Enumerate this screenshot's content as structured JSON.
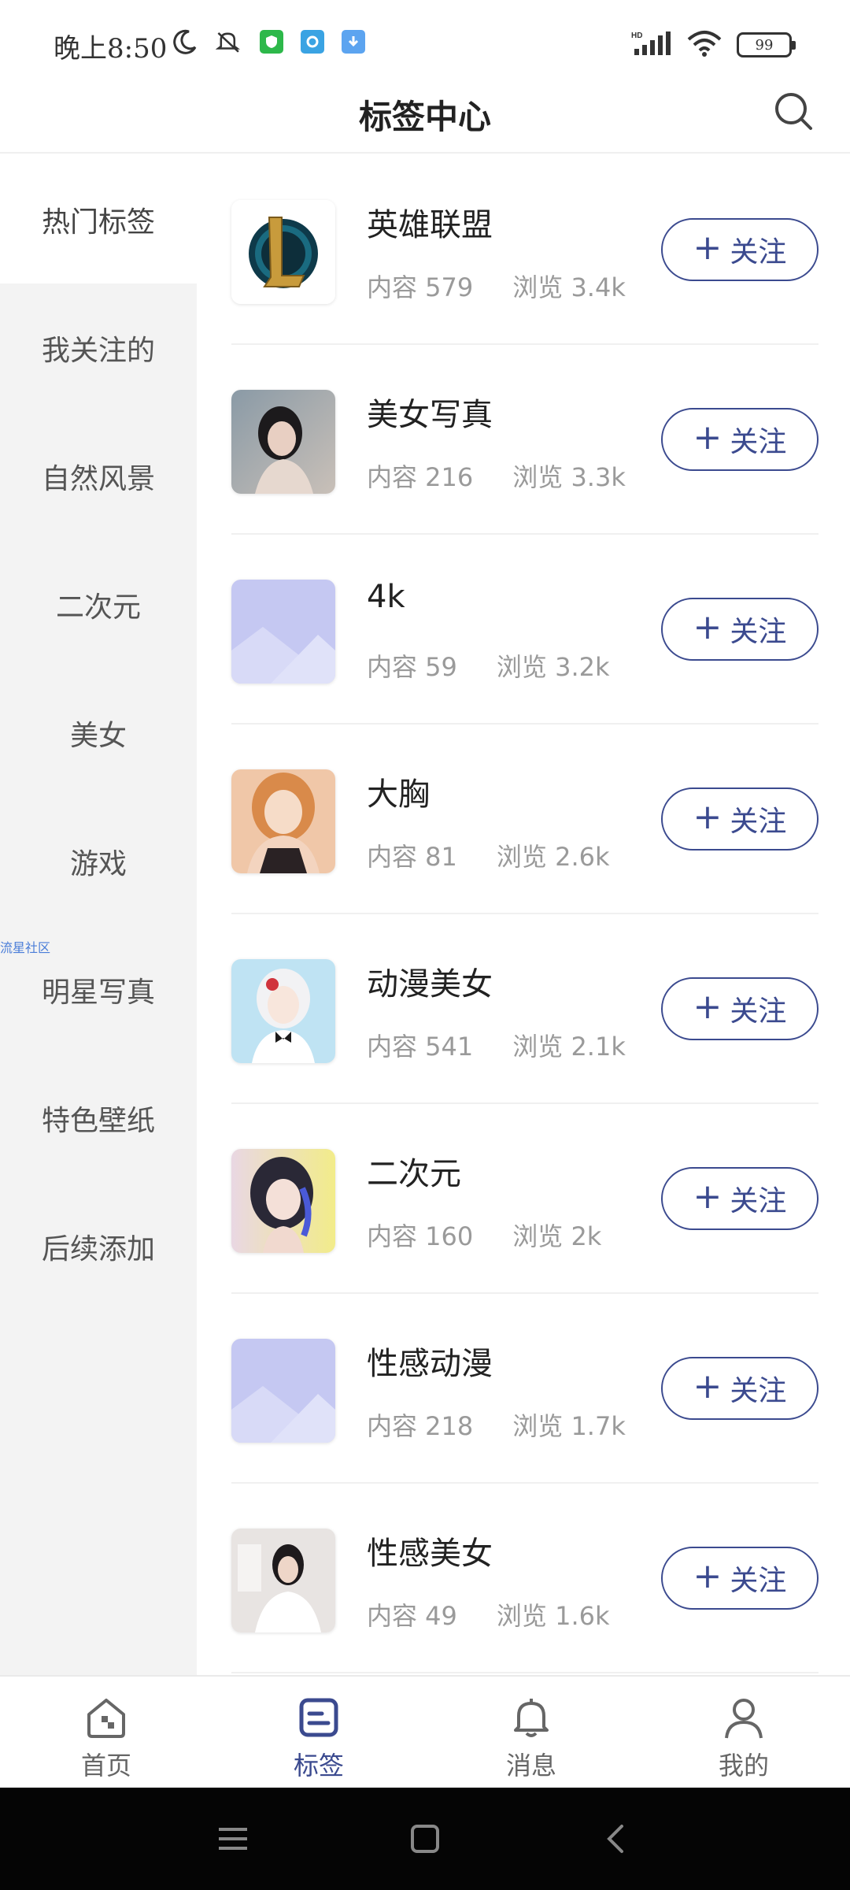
{
  "status_bar": {
    "time": "晚上8:50",
    "battery": "99"
  },
  "header": {
    "title": "标签中心"
  },
  "sidebar": {
    "items": [
      {
        "label": "热门标签",
        "active": true
      },
      {
        "label": "我关注的",
        "active": false
      },
      {
        "label": "自然风景",
        "active": false
      },
      {
        "label": "二次元",
        "active": false
      },
      {
        "label": "美女",
        "active": false
      },
      {
        "label": "游戏",
        "active": false
      },
      {
        "label": "明星写真",
        "active": false
      },
      {
        "label": "特色壁纸",
        "active": false
      },
      {
        "label": "后续添加",
        "active": false
      }
    ],
    "watermark": "流星社区"
  },
  "tags": [
    {
      "title": "英雄联盟",
      "content": "内容 579",
      "views": "浏览 3.4k",
      "follow": "关注",
      "thumb": "lol-logo"
    },
    {
      "title": "美女写真",
      "content": "内容 216",
      "views": "浏览 3.3k",
      "follow": "关注",
      "thumb": "photo"
    },
    {
      "title": "4k",
      "content": "内容 59",
      "views": "浏览 3.2k",
      "follow": "关注",
      "thumb": "placeholder"
    },
    {
      "title": "大胸",
      "content": "内容 81",
      "views": "浏览 2.6k",
      "follow": "关注",
      "thumb": "anime"
    },
    {
      "title": "动漫美女",
      "content": "内容 541",
      "views": "浏览 2.1k",
      "follow": "关注",
      "thumb": "anime-light"
    },
    {
      "title": "二次元",
      "content": "内容 160",
      "views": "浏览 2k",
      "follow": "关注",
      "thumb": "anime-dark"
    },
    {
      "title": "性感动漫",
      "content": "内容 218",
      "views": "浏览 1.7k",
      "follow": "关注",
      "thumb": "placeholder"
    },
    {
      "title": "性感美女",
      "content": "内容 49",
      "views": "浏览 1.6k",
      "follow": "关注",
      "thumb": "photo-light"
    }
  ],
  "bottom_nav": {
    "items": [
      {
        "label": "首页",
        "icon": "home-icon",
        "active": false
      },
      {
        "label": "标签",
        "icon": "tag-icon",
        "active": true
      },
      {
        "label": "消息",
        "icon": "bell-icon",
        "active": false
      },
      {
        "label": "我的",
        "icon": "user-icon",
        "active": false
      }
    ]
  },
  "colors": {
    "accent": "#3b4a8f",
    "sidebar_bg": "#f3f3f3",
    "placeholder": "#c5c8f2"
  }
}
